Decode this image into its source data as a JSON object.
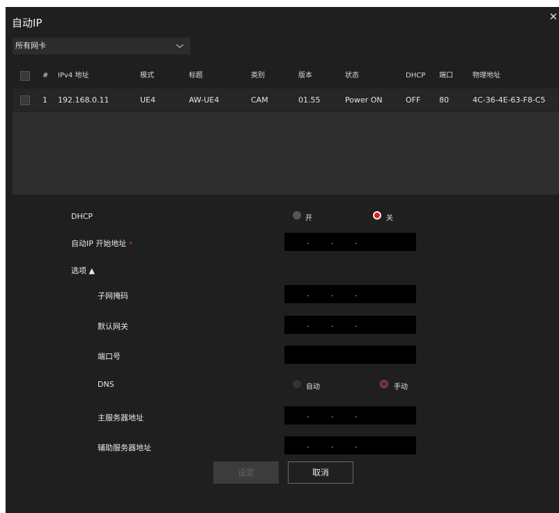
{
  "dialog": {
    "title": "自动IP",
    "close_icon": "close-icon"
  },
  "nic_select": {
    "value": "所有网卡",
    "icon": "chevron-down-icon"
  },
  "table": {
    "headers": [
      "#",
      "IPv4 地址",
      "模式",
      "标题",
      "类别",
      "版本",
      "状态",
      "DHCP",
      "端口",
      "物理地址"
    ],
    "rows": [
      {
        "index": "1",
        "ip": "192.168.0.11",
        "mode": "UE4",
        "title": "AW-UE4",
        "category": "CAM",
        "version": "01.55",
        "status": "Power ON",
        "dhcp": "OFF",
        "port": "80",
        "mac": "4C-36-4E-63-F8-C5"
      }
    ]
  },
  "form": {
    "dhcp_label": "DHCP",
    "dhcp_on": "开",
    "dhcp_off": "关",
    "dhcp_selected": "关",
    "start_label": "自动IP 开始地址",
    "required_mark": "*",
    "options_label": "选项 ▲",
    "subnet_label": "子网掩码",
    "gateway_label": "默认网关",
    "port_label": "端口号",
    "dns_label": "DNS",
    "dns_auto": "自动",
    "dns_manual": "手动",
    "dns_selected": "手动",
    "primary_dns_label": "主服务器地址",
    "secondary_dns_label": "辅助服务器地址"
  },
  "buttons": {
    "set": "设定",
    "cancel": "取消"
  },
  "colors": {
    "background": "#1f1f1f",
    "accent_radio": "#e0201a",
    "field": "#000000"
  }
}
